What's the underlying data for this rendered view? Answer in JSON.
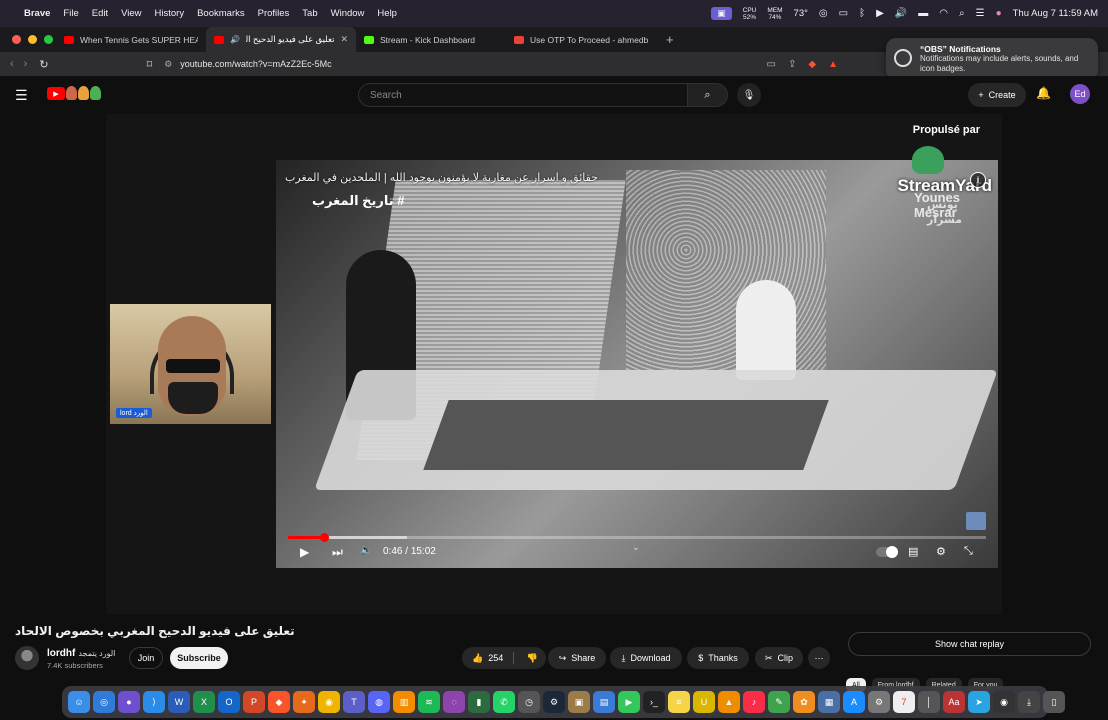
{
  "menubar": {
    "app_name": "Brave",
    "items": [
      "File",
      "Edit",
      "View",
      "History",
      "Bookmarks",
      "Profiles",
      "Tab",
      "Window",
      "Help"
    ],
    "cpu_label": "CPU",
    "cpu_value": "52%",
    "mem_label": "MEM",
    "mem_value": "74%",
    "temperature": "73°",
    "datetime": "Thu Aug 7  11:59 AM"
  },
  "tabs": [
    {
      "title": "When Tennis Gets SUPER HEATED",
      "favicon_color": "#ff0000",
      "active": false
    },
    {
      "title": "تعليق على فيديو الدحيح المغربي",
      "favicon_color": "#ff0000",
      "active": true
    },
    {
      "title": "Stream - Kick Dashboard",
      "favicon_color": "#53fc18",
      "active": false
    },
    {
      "title": "Use OTP To Proceed - ahmedbou",
      "favicon_color": "#ea4335",
      "active": false
    }
  ],
  "address": {
    "url": "youtube.com/watch?v=mAzZ2Ec-5Mc"
  },
  "notification": {
    "title": "“OBS” Notifications",
    "body": "Notifications may include alerts, sounds, and icon badges."
  },
  "header": {
    "search_placeholder": "Search",
    "create_label": "Create",
    "avatar_initials": "Ed"
  },
  "video": {
    "caption": "حقائق و اسرار عن مغاربة لا يؤمنون بوجود الله | الملحدين في المغرب",
    "hashtag": "# تاريخ المغرب",
    "watermark_line1": "Younes",
    "watermark_line2": "Mesrar",
    "watermark_ar1": "يونس",
    "watermark_ar2": "مسرار",
    "propulse": "Propulsé par",
    "streamyard": "StreamYard",
    "webcam_label": "lord الورد",
    "current_time": "0:46",
    "separator": " / ",
    "duration": "15:02",
    "progress_fraction": 0.051,
    "buffered_fraction": 0.17
  },
  "info": {
    "title": "تعليق على فيديو الدحيح المغربي بخصوص الالحاد",
    "channel_name": "lordhf",
    "channel_name_ar": "الورد يتمجد",
    "subscribers": "7.4K subscribers",
    "join_label": "Join",
    "subscribe_label": "Subscribe",
    "like_count": "254",
    "share_label": "Share",
    "download_label": "Download",
    "thanks_label": "Thanks",
    "clip_label": "Clip"
  },
  "chat": {
    "replay_label": "Show chat replay"
  },
  "chips": [
    "All",
    "From lordhf",
    "Related",
    "For you"
  ],
  "colors": {
    "yt_red": "#ff0000",
    "background": "#0f0f0f",
    "subscribe_bg": "#f1f1f1"
  }
}
